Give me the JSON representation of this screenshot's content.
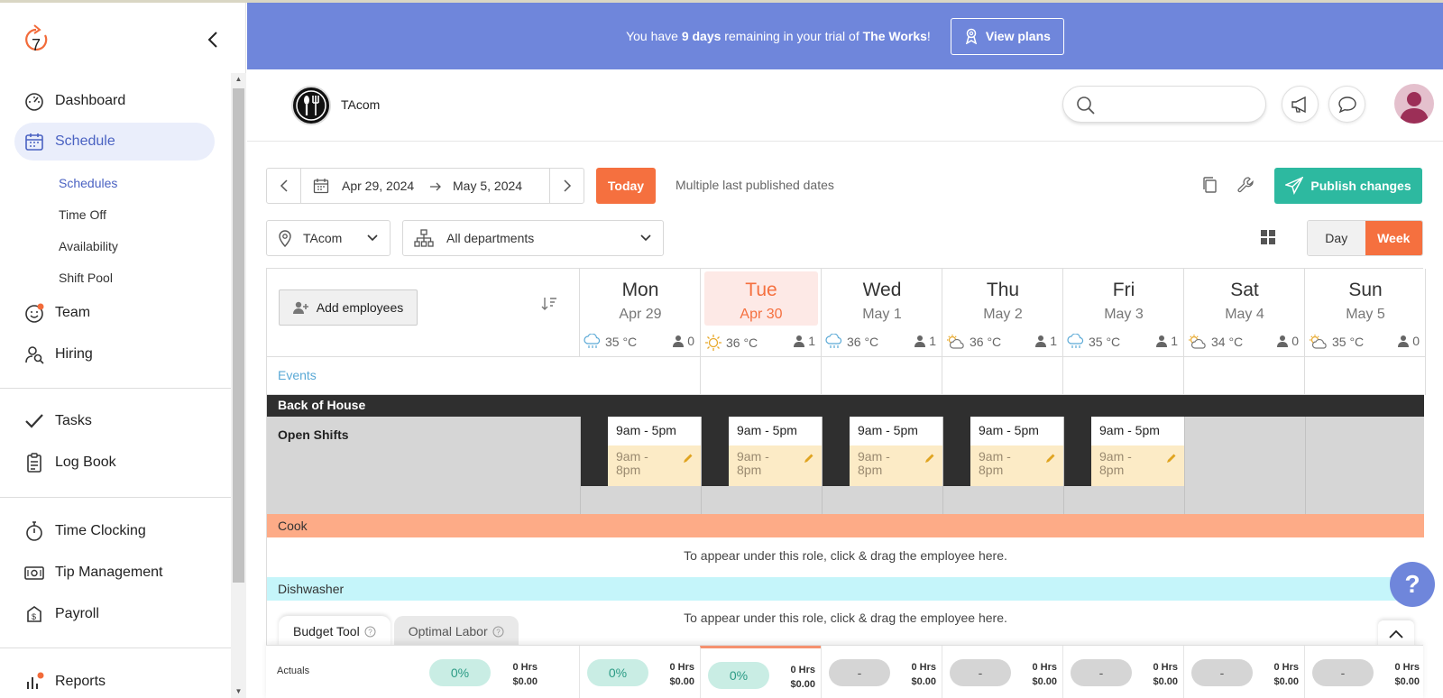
{
  "sidebar": {
    "logo_label": "7",
    "items": [
      {
        "label": "Dashboard",
        "icon": "dashboard-icon"
      },
      {
        "label": "Schedule",
        "icon": "calendar-icon"
      },
      {
        "label": "Team",
        "icon": "team-icon"
      },
      {
        "label": "Hiring",
        "icon": "hiring-icon"
      },
      {
        "label": "Tasks",
        "icon": "check-icon"
      },
      {
        "label": "Log Book",
        "icon": "clipboard-icon"
      },
      {
        "label": "Time Clocking",
        "icon": "stopwatch-icon"
      },
      {
        "label": "Tip Management",
        "icon": "cash-icon"
      },
      {
        "label": "Payroll",
        "icon": "payroll-icon"
      },
      {
        "label": "Reports",
        "icon": "chart-icon"
      }
    ],
    "sub_items": [
      "Schedules",
      "Time Off",
      "Availability",
      "Shift Pool"
    ]
  },
  "banner": {
    "pre": "You have ",
    "days": "9 days",
    "mid": " remaining in your trial of ",
    "plan": "The Works",
    "post": "!",
    "button": "View plans"
  },
  "header": {
    "org_name": "TAcom",
    "search_placeholder": ""
  },
  "toolbar": {
    "start_date": "Apr 29, 2024",
    "end_date": "May 5, 2024",
    "today": "Today",
    "last_published": "Multiple last published dates",
    "publish": "Publish changes",
    "location": "TAcom",
    "department": "All departments",
    "view_day": "Day",
    "view_week": "Week"
  },
  "schedule": {
    "add_employees": "Add employees",
    "events_label": "Events",
    "days": [
      {
        "name": "Mon",
        "date": "Apr 29",
        "temp": "35 °C",
        "weather": "rain",
        "count": "0"
      },
      {
        "name": "Tue",
        "date": "Apr 30",
        "temp": "36 °C",
        "weather": "sun",
        "count": "1"
      },
      {
        "name": "Wed",
        "date": "May 1",
        "temp": "36 °C",
        "weather": "rain",
        "count": "1"
      },
      {
        "name": "Thu",
        "date": "May 2",
        "temp": "36 °C",
        "weather": "partly-cloudy",
        "count": "1"
      },
      {
        "name": "Fri",
        "date": "May 3",
        "temp": "35 °C",
        "weather": "rain",
        "count": "1"
      },
      {
        "name": "Sat",
        "date": "May 4",
        "temp": "34 °C",
        "weather": "partly-cloudy",
        "count": "0"
      },
      {
        "name": "Sun",
        "date": "May 5",
        "temp": "35 °C",
        "weather": "partly-cloudy",
        "count": "0"
      }
    ],
    "section": "Back of House",
    "open_shifts_label": "Open Shifts",
    "open_shifts": [
      {
        "time": "9am - 5pm",
        "alt_line1": "9am -",
        "alt_line2": "8pm"
      },
      {
        "time": "9am - 5pm",
        "alt_line1": "9am -",
        "alt_line2": "8pm"
      },
      {
        "time": "9am - 5pm",
        "alt_line1": "9am -",
        "alt_line2": "8pm"
      },
      {
        "time": "9am - 5pm",
        "alt_line1": "9am -",
        "alt_line2": "8pm"
      },
      {
        "time": "9am - 5pm",
        "alt_line1": "9am -",
        "alt_line2": "8pm"
      }
    ],
    "roles": [
      {
        "name": "Cook",
        "color": "#fdab87",
        "hint": "To appear under this role, click & drag the employee here."
      },
      {
        "name": "Dishwasher",
        "color": "#c5f5fa",
        "hint": "To appear under this role, click & drag the employee here."
      }
    ]
  },
  "budget": {
    "tabs": [
      "Budget Tool",
      "Optimal Labor"
    ],
    "row_label": "Actuals",
    "total": {
      "pct": "0%",
      "hrs": "0 Hrs",
      "cost": "$0.00"
    },
    "cells": [
      {
        "pct": "0%",
        "hrs": "0 Hrs",
        "cost": "$0.00"
      },
      {
        "pct": "0%",
        "hrs": "0 Hrs",
        "cost": "$0.00"
      },
      {
        "pct": "-",
        "hrs": "0 Hrs",
        "cost": "$0.00"
      },
      {
        "pct": "-",
        "hrs": "0 Hrs",
        "cost": "$0.00"
      },
      {
        "pct": "-",
        "hrs": "0 Hrs",
        "cost": "$0.00"
      },
      {
        "pct": "-",
        "hrs": "0 Hrs",
        "cost": "$0.00"
      },
      {
        "pct": "-",
        "hrs": "0 Hrs",
        "cost": "$0.00"
      }
    ]
  },
  "help": "?",
  "colors": {
    "accent": "#f5703f",
    "primary": "#6f86db",
    "publish": "#2db9a0"
  }
}
